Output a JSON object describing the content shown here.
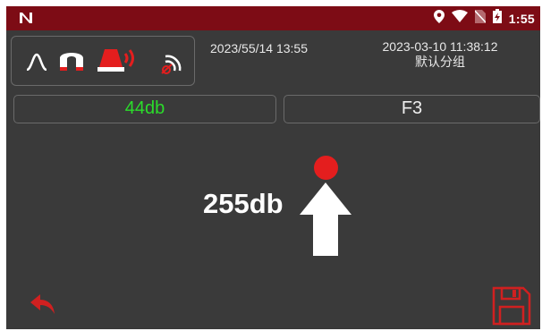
{
  "statusbar": {
    "time": "1:55",
    "icons": [
      "notification-n-icon",
      "location-icon",
      "wifi-icon",
      "no-sim-icon",
      "battery-charging-icon"
    ]
  },
  "toolbar": {
    "tools": [
      "peak-curve-icon",
      "magnet-icon",
      "alarm-horn-icon",
      "signal-off-icon"
    ]
  },
  "header": {
    "current_datetime": "2023/55/14 13:55",
    "record_datetime": "2023-03-10 11:38:12",
    "group_name": "默认分组"
  },
  "fields": {
    "left_value": "44db",
    "right_value": "F3"
  },
  "main": {
    "reading": "255db"
  },
  "colors": {
    "statusbar_bg": "#7d0c15",
    "screen_bg": "#3a3a3a",
    "accent_red": "#e41e1e",
    "value_green": "#2bdc2b"
  },
  "actions": [
    "back-icon",
    "save-icon"
  ]
}
